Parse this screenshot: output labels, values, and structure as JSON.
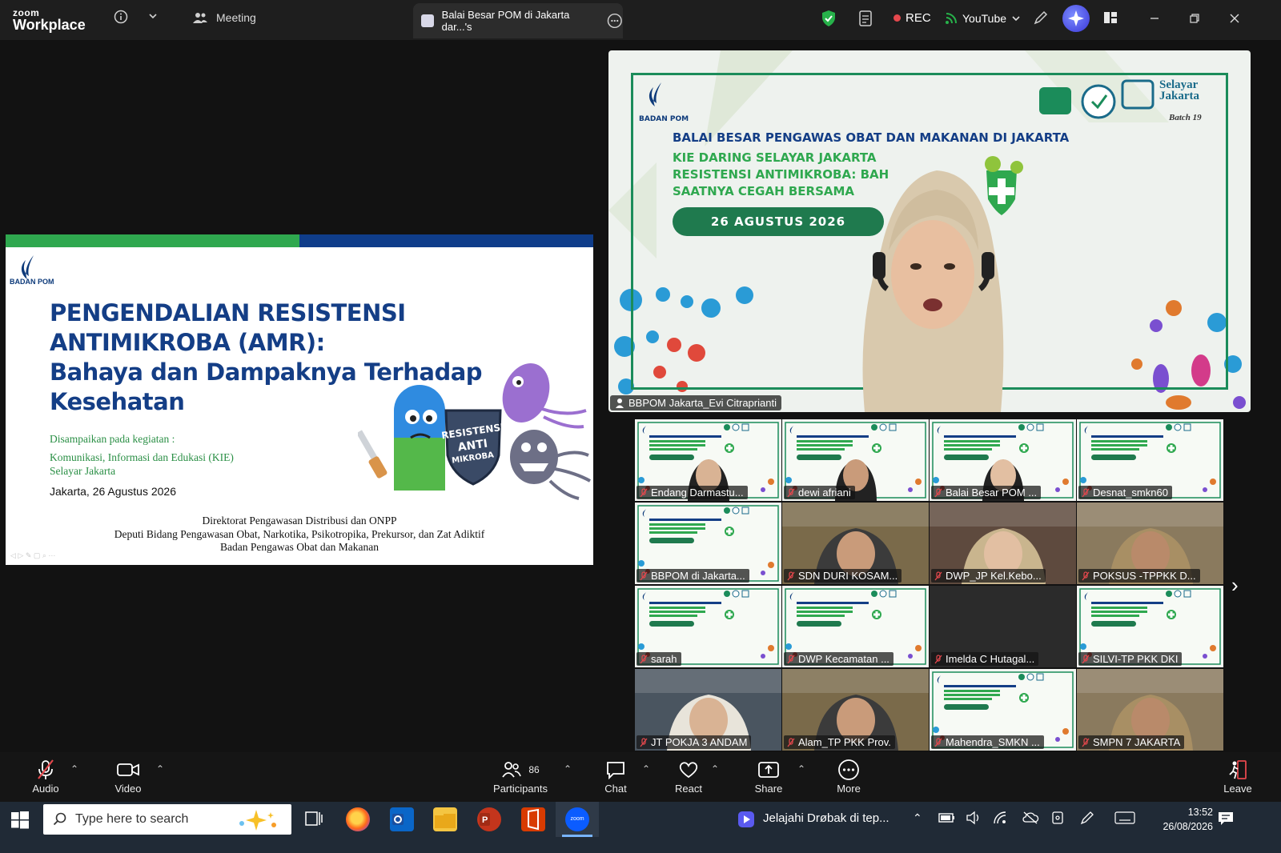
{
  "app": {
    "brand_small": "zoom",
    "brand_big": "Workplace"
  },
  "tabs": {
    "meeting": "Meeting",
    "active": "Balai Besar POM di Jakarta dar...'s"
  },
  "recording": {
    "label": "REC"
  },
  "stream": {
    "label": "YouTube"
  },
  "slide": {
    "logo_text": "BADAN POM",
    "title_line1": "PENGENDALIAN RESISTENSI ANTIMIKROBA (AMR):",
    "title_line2": "Bahaya dan Dampaknya Terhadap",
    "title_line3": "Kesehatan",
    "intro": "Disampaikan pada kegiatan  :",
    "event_line1": "Komunikasi, Informasi dan Edukasi (KIE)",
    "event_line2": "Selayar Jakarta",
    "date": "Jakarta, 26 Agustus 2026",
    "footer1": "Direktorat Pengawasan Distribusi dan ONPP",
    "footer2": "Deputi Bidang Pengawasan Obat, Narkotika, Psikotropika, Prekursor, dan Zat Adiktif",
    "footer3": "Badan Pengawas Obat dan Makanan",
    "shield_text1": "RESISTENSI",
    "shield_text2": "ANTI",
    "shield_text3": "MIKROBA"
  },
  "speaker": {
    "logo_text": "BADAN POM",
    "title": "BALAI BESAR PENGAWAS OBAT DAN MAKANAN DI JAKARTA",
    "line1": "KIE DARING SELAYAR JAKARTA",
    "line2": "RESISTENSI ANTIMIKROBA: BAHAYA",
    "line3": "SAATNYA CEGAH BERSAMA",
    "date": "26 AGUSTUS 2026",
    "selayar1": "Selayar",
    "selayar2": "Jakarta",
    "batch": "Batch 19",
    "name": "BBPOM Jakarta_Evi Citraprianti"
  },
  "gallery": [
    {
      "name": "Endang Darmastu...",
      "kind": "banner-face"
    },
    {
      "name": "dewi afriani",
      "kind": "banner-face"
    },
    {
      "name": "Balai Besar POM ...",
      "kind": "banner-face"
    },
    {
      "name": "Desnat_smkn60",
      "kind": "banner"
    },
    {
      "name": "BBPOM di Jakarta...",
      "kind": "banner"
    },
    {
      "name": "SDN DURI KOSAM...",
      "kind": "face"
    },
    {
      "name": "DWP_JP Kel.Kebo...",
      "kind": "face"
    },
    {
      "name": "POKSUS -TPPKK D...",
      "kind": "face"
    },
    {
      "name": "sarah",
      "kind": "banner"
    },
    {
      "name": "DWP Kecamatan ...",
      "kind": "banner"
    },
    {
      "name": "Imelda C Hutagal...",
      "kind": "dark"
    },
    {
      "name": "SILVI-TP PKK DKI",
      "kind": "banner"
    },
    {
      "name": "JT POKJA 3 ANDAM",
      "kind": "face"
    },
    {
      "name": "Alam_TP PKK Prov.",
      "kind": "face"
    },
    {
      "name": "Mahendra_SMKN ...",
      "kind": "banner"
    },
    {
      "name": "SMPN 7 JAKARTA",
      "kind": "face"
    }
  ],
  "toolbar": {
    "audio": "Audio",
    "video": "Video",
    "participants": "Participants",
    "participants_count": "86",
    "chat": "Chat",
    "react": "React",
    "share": "Share",
    "more": "More",
    "leave": "Leave"
  },
  "taskbar": {
    "search_placeholder": "Type here to search",
    "notification": "Jelajahi Drøbak di tep...",
    "time": "13:52",
    "date": "26/08/2026"
  },
  "colors": {
    "accent_green": "#2fa84f",
    "accent_blue": "#0f3d8a",
    "zoom_blue": "#0b5cff",
    "rec_red": "#e5484d"
  }
}
